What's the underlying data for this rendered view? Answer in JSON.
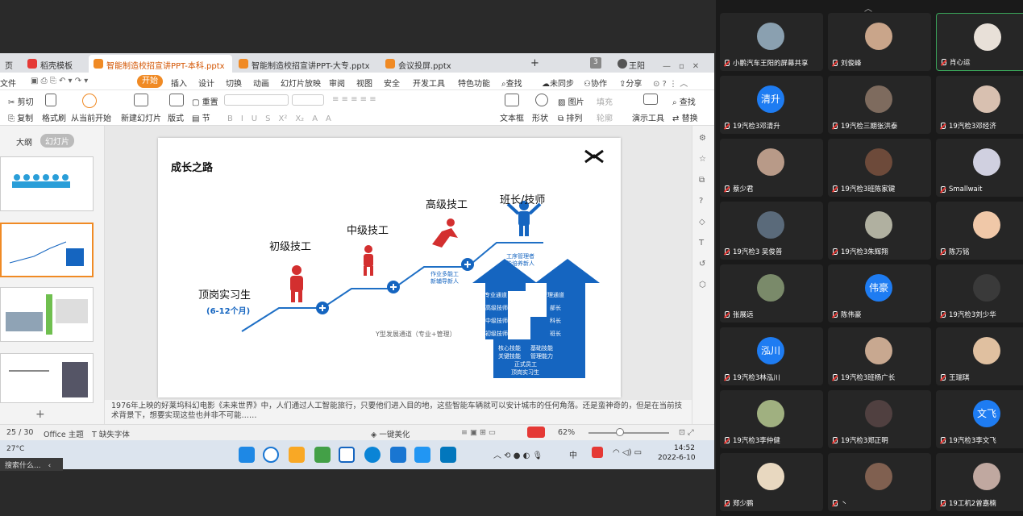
{
  "wps": {
    "tabs": [
      {
        "label": "页"
      },
      {
        "label": "稻壳模板"
      },
      {
        "label": "智能制造校招宣讲PPT-本科.pptx"
      },
      {
        "label": "智能制造校招宣讲PPT-大专.pptx"
      },
      {
        "label": "会议投屏.pptx"
      }
    ],
    "tab_add": "+",
    "user_badge": "3",
    "user_name": "王阳",
    "menu": [
      "文件",
      "开始",
      "插入",
      "设计",
      "切换",
      "动画",
      "幻灯片放映",
      "审阅",
      "视图",
      "安全",
      "开发工具",
      "特色功能"
    ],
    "search_label": "查找",
    "sync_label": "未同步",
    "collab_label": "协作",
    "share_label": "分享",
    "ribbon": {
      "cut": "剪切",
      "copy": "复制",
      "format_painter": "格式刷",
      "play_from_current": "从当前开始",
      "new_slide": "新建幻灯片",
      "layout": "版式",
      "section": "节",
      "reset": "重置",
      "textbox": "文本框",
      "shape": "形状",
      "arrange": "排列",
      "picture": "图片",
      "fill": "填充",
      "outline": "轮廓",
      "presenter_tools": "演示工具",
      "find": "查找",
      "replace": "替换"
    },
    "panel_tabs": [
      "大纲",
      "幻灯片"
    ],
    "slide": {
      "title": "成长之路",
      "steps": [
        "顶岗实习生",
        "初级技工",
        "中级技工",
        "高级技工",
        "班长/技师"
      ],
      "intern_period": "(6-12个月)",
      "senior_note": [
        "作业多能工",
        "新辅导新人"
      ],
      "leader_note": [
        "工序管理者",
        "能培养新人"
      ],
      "left_channel": "专业通道",
      "right_channel": "管理通道",
      "left_items": [
        "高级技师",
        "中级技师",
        "初级技师"
      ],
      "right_items": [
        "部长",
        "科长",
        "班长"
      ],
      "base_items": [
        "核心技能",
        "基础技能",
        "关键技能",
        "管理能力",
        "正式员工",
        "顶岗实习生"
      ],
      "y_caption": "Y型发展通道（专业+管理）"
    },
    "notes": "1976年上映的好莱坞科幻电影《未来世界》中，人们通过人工智能旅行，只要他们进入目的地，这些智能车辆就可以安计城市的任何角落。还是蛮神奇的，但是在当前技术背景下，想要实现这些也并非不可能……",
    "status": {
      "page": "25 / 30",
      "theme": "Office 主题",
      "missing_font": "缺失字体",
      "beautify": "一键美化",
      "zoom": "62%"
    }
  },
  "taskbar": {
    "weather_temp": "27°C",
    "search_hint": "搜索什么...",
    "time": "14:52",
    "date": "2022-6-10",
    "ime": "中"
  },
  "participants": [
    {
      "name": "小鹏汽车王阳的屏幕共享",
      "avatar_text": ""
    },
    {
      "name": "刘俊峰",
      "avatar_text": ""
    },
    {
      "name": "肖心运",
      "avatar_text": ""
    },
    {
      "name": "19汽检3邓清升",
      "avatar_text": "清升"
    },
    {
      "name": "19汽检三期张洪泰",
      "avatar_text": ""
    },
    {
      "name": "19汽检3邓经济",
      "avatar_text": ""
    },
    {
      "name": "蔡少君",
      "avatar_text": ""
    },
    {
      "name": "19汽检3班陈家键",
      "avatar_text": ""
    },
    {
      "name": "Smallwait",
      "avatar_text": ""
    },
    {
      "name": "19汽检3 吴俊普",
      "avatar_text": ""
    },
    {
      "name": "19汽检3朱辉翔",
      "avatar_text": ""
    },
    {
      "name": "陈万铭",
      "avatar_text": ""
    },
    {
      "name": "张展远",
      "avatar_text": ""
    },
    {
      "name": "陈伟豪",
      "avatar_text": "伟豪"
    },
    {
      "name": "19汽检3刘少华",
      "avatar_text": ""
    },
    {
      "name": "19汽检3林泓川",
      "avatar_text": "泓川"
    },
    {
      "name": "19汽检3班杨广长",
      "avatar_text": ""
    },
    {
      "name": "王瑞琪",
      "avatar_text": ""
    },
    {
      "name": "19汽检3李仲健",
      "avatar_text": ""
    },
    {
      "name": "19汽检3郑正明",
      "avatar_text": ""
    },
    {
      "name": "19汽检3李文飞",
      "avatar_text": "文飞"
    },
    {
      "name": "郑少鹏",
      "avatar_text": ""
    },
    {
      "name": "丶",
      "avatar_text": ""
    },
    {
      "name": "19工机2曾嘉楠",
      "avatar_text": ""
    }
  ],
  "colors": {
    "accent_orange": "#f08a24",
    "slide_blue": "#1565c0",
    "slide_red": "#d32f2f",
    "avatar_blue": "#1e7cf2"
  }
}
